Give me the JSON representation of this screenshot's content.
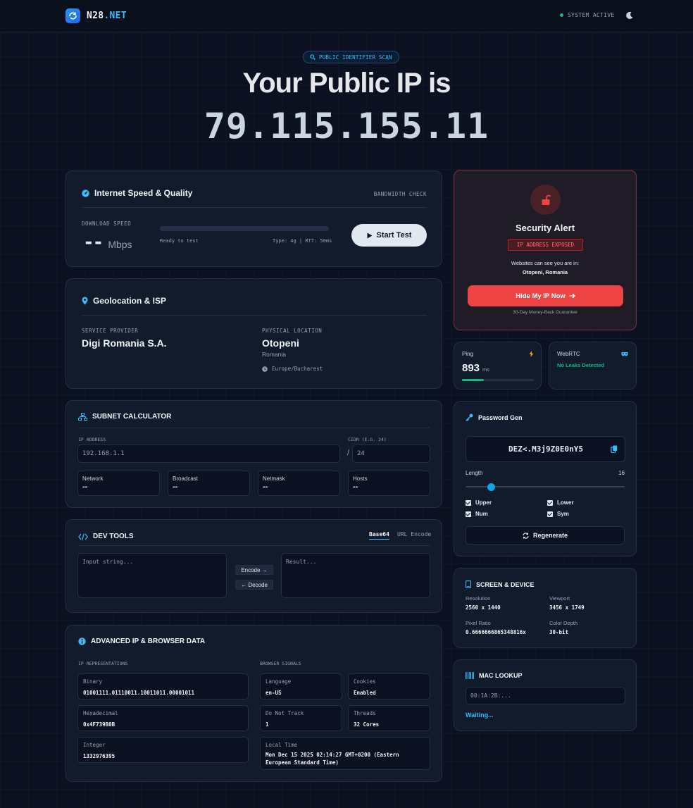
{
  "header": {
    "brand_main": "N28",
    "brand_tld": ".NET",
    "status": "SYSTEM ACTIVE"
  },
  "hero": {
    "pill": "PUBLIC IDENTIFIER SCAN",
    "title": "Your Public IP is",
    "ip": "79.115.155.11"
  },
  "speed": {
    "title": "Internet Speed & Quality",
    "tag": "BANDWIDTH CHECK",
    "download_label": "DOWNLOAD SPEED",
    "value": "--",
    "unit": "Mbps",
    "ready": "Ready to test",
    "meta": "Type: 4g | RTT: 50ms",
    "button": "Start Test",
    "progress_percent": 0
  },
  "geo": {
    "title": "Geolocation & ISP",
    "provider_label": "SERVICE PROVIDER",
    "provider": "Digi Romania S.A.",
    "location_label": "PHYSICAL LOCATION",
    "city": "Otopeni",
    "country": "Romania",
    "timezone": "Europe/Bucharest"
  },
  "subnet": {
    "title": "SUBNET CALCULATOR",
    "ip_label": "IP ADDRESS",
    "ip_placeholder": "192.168.1.1",
    "cidr_label": "CIDR (E.G. 24)",
    "cidr_placeholder": "24",
    "slash": "/",
    "results": [
      {
        "label": "Network",
        "value": "--"
      },
      {
        "label": "Broadcast",
        "value": "--"
      },
      {
        "label": "Netmask",
        "value": "--"
      },
      {
        "label": "Hosts",
        "value": "--"
      }
    ]
  },
  "devtools": {
    "title": "DEV TOOLS",
    "tabs": [
      "Base64",
      "URL Encode"
    ],
    "input_placeholder": "Input string...",
    "result_placeholder": "Result...",
    "encode": "Encode →",
    "decode": "← Decode"
  },
  "advanced": {
    "title": "ADVANCED IP & BROWSER DATA",
    "ip_section": "IP REPRESENTATIONS",
    "browser_section": "BROWSER SIGNALS",
    "binary_label": "Binary",
    "binary": "01001111.01110011.10011011.00001011",
    "hex_label": "Hexadecimal",
    "hex": "0x4F739B0B",
    "int_label": "Integer",
    "int": "1332976395",
    "language_label": "Language",
    "language": "en-US",
    "cookies_label": "Cookies",
    "cookies": "Enabled",
    "dnt_label": "Do Not Track",
    "dnt": "1",
    "threads_label": "Threads",
    "threads": "32 Cores",
    "localtime_label": "Local Time",
    "localtime": "Mon Dec 15 2025 02:14:27 GMT+0200 (Eastern European Standard Time)"
  },
  "security": {
    "title": "Security Alert",
    "badge": "IP ADDRESS EXPOSED",
    "text": "Websites can see you are in:",
    "location": "Otopeni, Romania",
    "button": "Hide My IP Now",
    "guarantee": "30-Day Money-Back Guarantee"
  },
  "ping": {
    "label": "Ping",
    "value": "893",
    "unit": "ms",
    "bar_fraction": 0.3
  },
  "webrtc": {
    "label": "WebRTC",
    "status": "No Leaks Detected"
  },
  "password": {
    "title": "Password Gen",
    "value": "DEZ<.M3j9Z0E0nY5",
    "length_label": "Length",
    "length": "16",
    "slider_fraction": 0.16,
    "options": [
      "Upper",
      "Lower",
      "Num",
      "Sym"
    ],
    "regenerate": "Regenerate"
  },
  "screen": {
    "title": "SCREEN & DEVICE",
    "resolution_label": "Resolution",
    "resolution": "2560 x 1440",
    "viewport_label": "Viewport",
    "viewport": "3456 x 1749",
    "ratio_label": "Pixel Ratio",
    "ratio": "0.6666666865348816x",
    "depth_label": "Color Depth",
    "depth": "30-bit"
  },
  "mac": {
    "title": "MAC LOOKUP",
    "placeholder": "00:1A:2B:...",
    "status": "Waiting..."
  },
  "colors": {
    "accent": "#38bdf8",
    "danger": "#ef4444",
    "success": "#10b981",
    "warning": "#f59e0b"
  }
}
